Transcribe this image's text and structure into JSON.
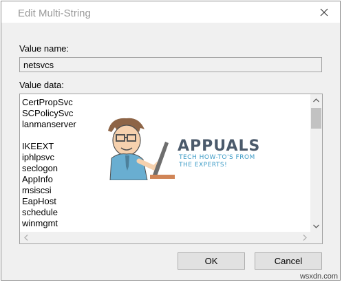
{
  "dialog": {
    "title": "Edit Multi-String"
  },
  "value_name": {
    "label": "Value name:",
    "value": "netsvcs"
  },
  "value_data": {
    "label": "Value data:",
    "lines": [
      "CertPropSvc",
      "SCPolicySvc",
      "lanmanserver",
      "",
      "IKEEXT",
      "iphlpsvc",
      "seclogon",
      "AppInfo",
      "msiscsi",
      "EapHost",
      "schedule",
      "winmgmt"
    ]
  },
  "buttons": {
    "ok": "OK",
    "cancel": "Cancel"
  },
  "watermark": {
    "brand": "APPUALS",
    "tagline_1": "TECH HOW-TO'S FROM",
    "tagline_2": "THE EXPERTS!",
    "site": "wsxdn.com"
  },
  "colors": {
    "title_text": "#9a9a9a",
    "dialog_bg": "#f0f0f0",
    "button_bg": "#e1e1e1"
  }
}
